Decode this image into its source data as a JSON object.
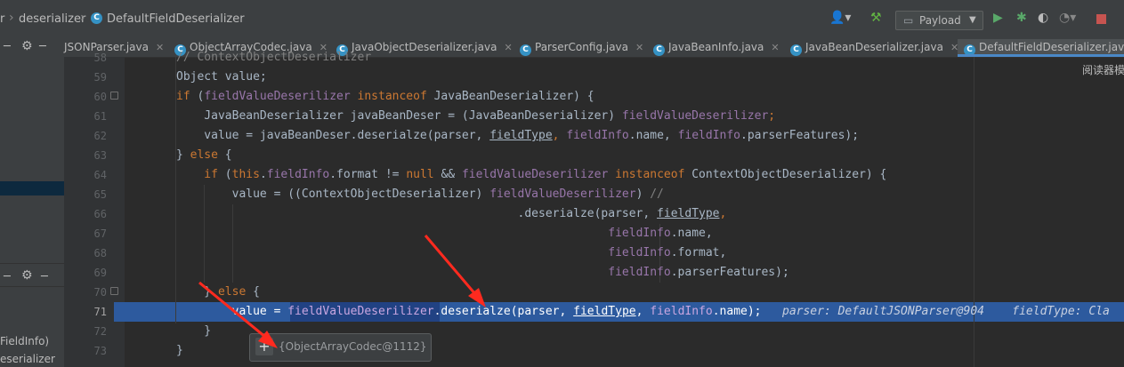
{
  "breadcrumb": {
    "prefix": "r",
    "package": "deserializer",
    "class": "DefaultFieldDeserializer",
    "class_icon": "C"
  },
  "toolbar": {
    "run_config": "Payload",
    "icons": [
      "user-icon",
      "build-hammer-icon",
      "run-icon",
      "debug-icon",
      "coverage-icon",
      "profile-icon",
      "stop-icon"
    ]
  },
  "tabs": [
    {
      "label": "JSONParser.java",
      "icon": ""
    },
    {
      "label": "ObjectArrayCodec.java",
      "icon": "C"
    },
    {
      "label": "JavaObjectDeserializer.java",
      "icon": "C"
    },
    {
      "label": "ParserConfig.java",
      "icon": "C"
    },
    {
      "label": "JavaBeanInfo.java",
      "icon": "C"
    },
    {
      "label": "JavaBeanDeserializer.java",
      "icon": "C"
    },
    {
      "label": "DefaultFieldDeserializer.java",
      "icon": "C"
    }
  ],
  "right_panel": {
    "label": "阅读器模"
  },
  "left_panel": {
    "line1": "FieldInfo)",
    "line2": "eserializer"
  },
  "line_numbers": [
    "58",
    "59",
    "60",
    "61",
    "62",
    "63",
    "64",
    "65",
    "66",
    "67",
    "68",
    "69",
    "70",
    "71",
    "72",
    "73"
  ],
  "code": {
    "l58": "// ContextObjectDeserializer",
    "l59": "Object value;",
    "l60a": "if",
    "l60b": " (",
    "l60c": "fieldValueDeserilizer",
    "l60d": " instanceof",
    "l60e": " JavaBeanDeserializer) {",
    "l61a": "    JavaBeanDeserializer javaBeanDeser = (JavaBeanDeserializer) ",
    "l61b": "fieldValueDeserilizer",
    "l61c": ";",
    "l62a": "    value = javaBeanDeser.deserialze(parser, ",
    "l62b": "fieldType",
    "l62c": ", ",
    "l62d": "fieldInfo",
    "l62e": ".name, ",
    "l62f": "fieldInfo",
    "l62g": ".parserFeatures);",
    "l63a": "} ",
    "l63b": "else",
    "l63c": " {",
    "l64a": "    if",
    "l64b": " (",
    "l64c": "this",
    "l64d": ".",
    "l64e": "fieldInfo",
    "l64f": ".format != ",
    "l64g": "null",
    "l64h": " && ",
    "l64i": "fieldValueDeserilizer",
    "l64j": " instanceof",
    "l64k": " ContextObjectDeserializer) {",
    "l65a": "        value = ((ContextObjectDeserializer) ",
    "l65b": "fieldValueDeserilizer",
    "l65c": ") ",
    "l65d": "//",
    "l66a": "                                                 .deserialze(parser, ",
    "l66b": "fieldType",
    "l66c": ",",
    "l67a": "                                                              ",
    "l67b": "fieldInfo",
    "l67c": ".name,",
    "l68a": "                                                              ",
    "l68b": "fieldInfo",
    "l68c": ".format,",
    "l69a": "                                                              ",
    "l69b": "fieldInfo",
    "l69c": ".parserFeatures);",
    "l70a": "    } ",
    "l70b": "else",
    "l70c": " {",
    "l71a": "        value = ",
    "l71b": "fieldValueDeserilizer",
    "l71c": ".deserialze(parser, ",
    "l71d": "fieldType",
    "l71e": ", ",
    "l71f": "fieldInfo",
    "l71g": ".name);",
    "l71hint": "   parser: DefaultJSONParser@904    fieldType: Cla",
    "l72": "    }",
    "l73": "}"
  },
  "popup": {
    "text": "{ObjectArrayCodec@1112}"
  }
}
